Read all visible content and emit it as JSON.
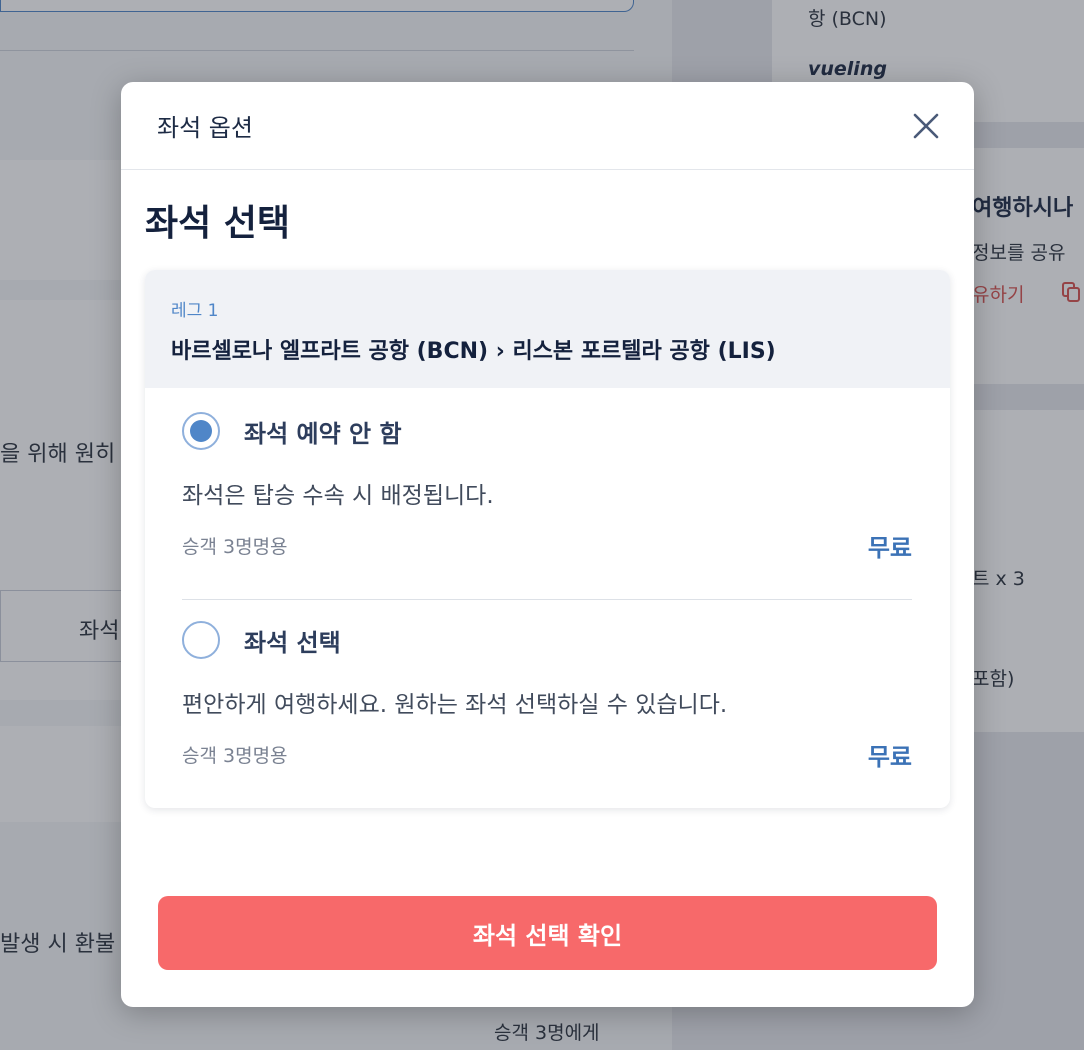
{
  "background": {
    "right_airport": "항 (BCN)",
    "airline_logo": "vueling",
    "trip_heading": "여행하시나",
    "share_info": "정보를 공유",
    "share_link": "유하기",
    "pax_count": "트 x 3",
    "included": "포함)",
    "left_text_1": "을 위해 원히",
    "left_button": "좌석",
    "left_text_2": "발생 시 환불",
    "bottom_text": "승객 3명에게"
  },
  "modal": {
    "header_title": "좌석 옵션",
    "section_title": "좌석 선택",
    "leg": {
      "label": "레그 1",
      "route": "바르셀로나 엘프라트 공항 (BCN) › 리스본 포르텔라 공항 (LIS)"
    },
    "options": [
      {
        "name": "좌석 예약 안 함",
        "description": "좌석은 탑승 수속 시 배정됩니다.",
        "passengers": "승객 3명명용",
        "price": "무료",
        "selected": true
      },
      {
        "name": "좌석 선택",
        "description": "편안하게 여행하세요. 원하는 좌석 선택하실 수 있습니다.",
        "passengers": "승객 3명명용",
        "price": "무료",
        "selected": false
      }
    ],
    "confirm_label": "좌석 선택 확인"
  },
  "colors": {
    "accent_blue": "#4f86c8",
    "confirm_button": "#f7696a",
    "title_navy": "#14213d"
  },
  "icons": {
    "close": "close-icon",
    "copy": "copy-icon"
  }
}
